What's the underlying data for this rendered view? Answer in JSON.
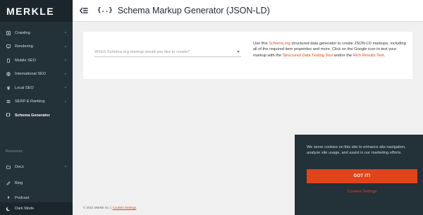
{
  "brand": {
    "logo_text": "MERKLE"
  },
  "header": {
    "title_icon": "{..}",
    "title": "Schema Markup Generator (JSON-LD)"
  },
  "sidebar": {
    "items": [
      {
        "label": "Crawling",
        "icon": "crawl-icon"
      },
      {
        "label": "Rendering",
        "icon": "monitor-icon"
      },
      {
        "label": "Mobile SEO",
        "icon": "mobile-icon"
      },
      {
        "label": "International SEO",
        "icon": "globe-icon"
      },
      {
        "label": "Local SEO",
        "icon": "map-pin-icon"
      },
      {
        "label": "SERP & Ranking",
        "icon": "list-icon"
      },
      {
        "label": "Schema Generator",
        "icon": "braces-icon",
        "active": true
      }
    ],
    "resources_label": "Resources",
    "resources": [
      {
        "label": "Docs",
        "icon": "folder-icon"
      },
      {
        "label": "Blog",
        "icon": "pencil-icon"
      },
      {
        "label": "Podcast",
        "icon": "mic-icon"
      }
    ],
    "dark_mode_label": "Dark Mode"
  },
  "main": {
    "select_placeholder": "Which Schema.org markup would you like to create?",
    "desc_1": "Use this ",
    "desc_link_1": "Schema.org",
    "desc_2": " structured data generator to create JSON-LD markups, including all of the required item properties and more. Click on the Google icon to test your markup with the ",
    "desc_link_2": "Structured Data Testing Tool",
    "desc_3": " and/or the ",
    "desc_link_3": "Rich Results Test",
    "desc_4": "."
  },
  "footer": {
    "copyright": "© 2021 Merkle Inc. | ",
    "cookie_link": "Cookies Settings"
  },
  "cookie_banner": {
    "text": "We serve cookies on this site to enhance site navigation, analyze site usage, and assist in our marketing efforts.",
    "accept_label": "GOT IT!",
    "settings_label": "Cookies Settings"
  },
  "colors": {
    "accent": "#e0441b",
    "sidebar_bg": "#233139"
  }
}
